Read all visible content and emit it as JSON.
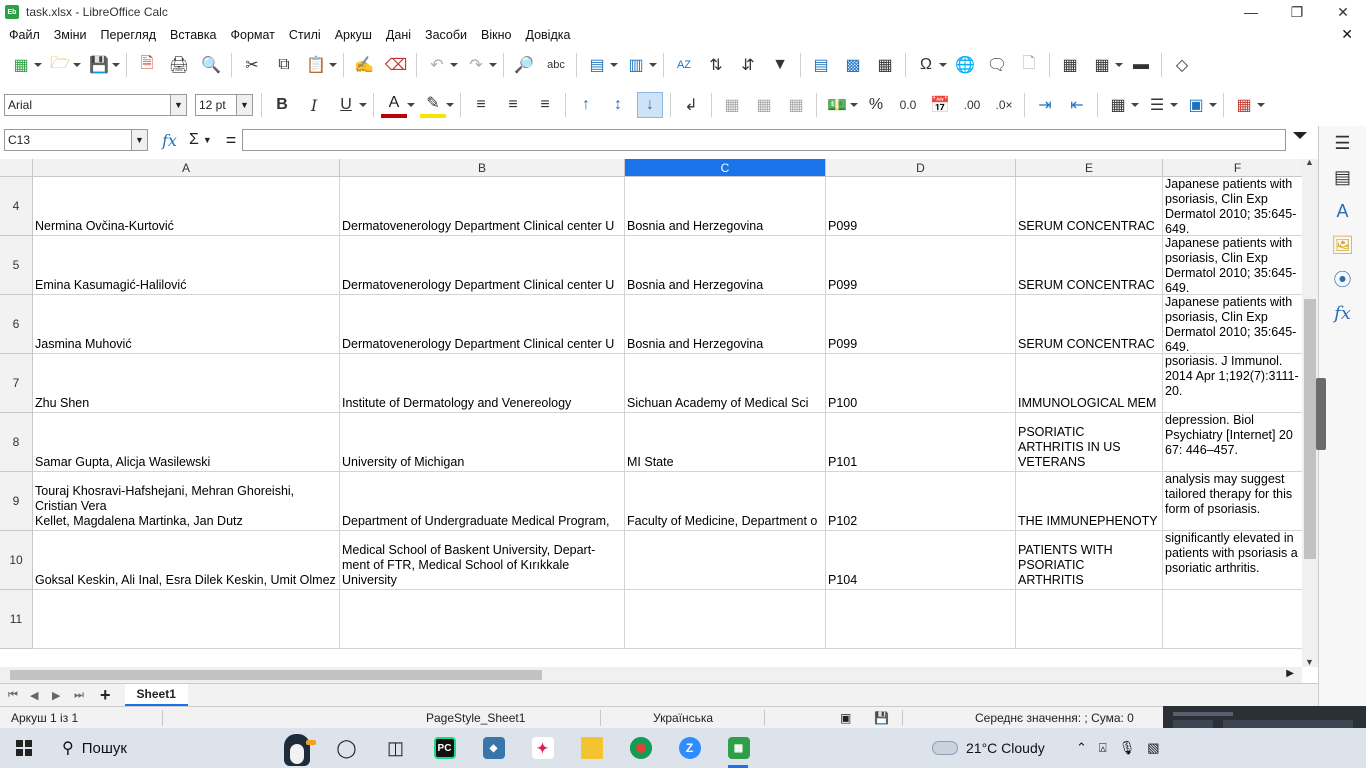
{
  "window": {
    "title": "task.xlsx - LibreOffice Calc",
    "app_icon_text": "Eb"
  },
  "menu": [
    "Файл",
    "Зміни",
    "Перегляд",
    "Вставка",
    "Формат",
    "Стилі",
    "Аркуш",
    "Дані",
    "Засоби",
    "Вікно",
    "Довідка"
  ],
  "format": {
    "font_name": "Arial",
    "font_size": "12 pt"
  },
  "formula_bar": {
    "cell_ref": "C13",
    "fx": "fx",
    "sigma": "Σ",
    "equals": "=",
    "content": ""
  },
  "columns": [
    "A",
    "B",
    "C",
    "D",
    "E",
    "F"
  ],
  "selected_column": "C",
  "rows": [
    {
      "num": "4",
      "A": "Nermina Ovčina-Kurtović",
      "B": "Dermatovenerology Department Clinical center U",
      "C": "Bosnia and Herzegovina",
      "D": "P099",
      "E": "SERUM CONCENTRAC",
      "F": "Japanese patients with psoriasis, Clin Exp Dermatol 2010; 35:645-649."
    },
    {
      "num": "5",
      "A": "Emina Kasumagić-Halilović",
      "B": "Dermatovenerology Department Clinical center U",
      "C": "Bosnia and Herzegovina",
      "D": "P099",
      "E": "SERUM CONCENTRAC",
      "F": "Japanese patients with psoriasis, Clin Exp Dermatol 2010; 35:645-649."
    },
    {
      "num": "6",
      "A": "Jasmina Muhović",
      "B": "Dermatovenerology Department Clinical center U",
      "C": "Bosnia and Herzegovina",
      "D": "P099",
      "E": "SERUM CONCENTRAC",
      "F": "Japanese patients with psoriasis, Clin Exp Dermatol 2010; 35:645-649."
    },
    {
      "num": "7",
      "A": "Zhu Shen",
      "B": "Institute of Dermatology and Venereology",
      "C": "Sichuan Academy of Medical Sci",
      "D": "P100",
      "E": "IMMUNOLOGICAL MEM",
      "F": "psoriasis. J Immunol. 2014 Apr 1;192(7):3111-20."
    },
    {
      "num": "8",
      "A": "Samar Gupta, Alicja Wasilewski",
      "B": "University of Michigan",
      "C": "MI State",
      "D": "P101",
      "E": "PSORIATIC\nARTHRITIS IN US\nVETERANS",
      "F": "depression. Biol Psychiatry [Internet] 20 67: 446–457."
    },
    {
      "num": "9",
      "A": "Touraj Khosravi-Hafshejani, Mehran Ghoreishi, Cristian Vera\nKellet, Magdalena Martinka, Jan Dutz",
      "B": "Department of Undergraduate Medical Program,",
      "C": "Faculty of Medicine, Department o",
      "D": "P102",
      "E": "THE IMMUNEPHENOTY",
      "F": "analysis may suggest tailored therapy for this form of psoriasis."
    },
    {
      "num": "10",
      "A": "Goksal Keskin, Ali Inal, Esra Dilek Keskin, Umit Olmez",
      "B": "Medical School of Baskent University, Depart-\nment of FTR, Medical School of Kırıkkale\nUniversity",
      "C": "",
      "D": "P104",
      "E": "PATIENTS WITH\nPSORIATIC\nARTHRITIS",
      "F": "significantly elevated in patients with psoriasis a psoriatic arthritis."
    },
    {
      "num": "11",
      "A": "",
      "B": "",
      "C": "",
      "D": "",
      "E": "",
      "F": ""
    }
  ],
  "sheet_tab": "Sheet1",
  "status": {
    "sheet": "Аркуш 1 із 1",
    "page_style": "PageStyle_Sheet1",
    "language": "Українська",
    "summary": "Середнє значення: ; Сума: 0"
  },
  "taskbar": {
    "search": "Пошук",
    "temperature": "21°C",
    "weather": "Cloudy"
  }
}
